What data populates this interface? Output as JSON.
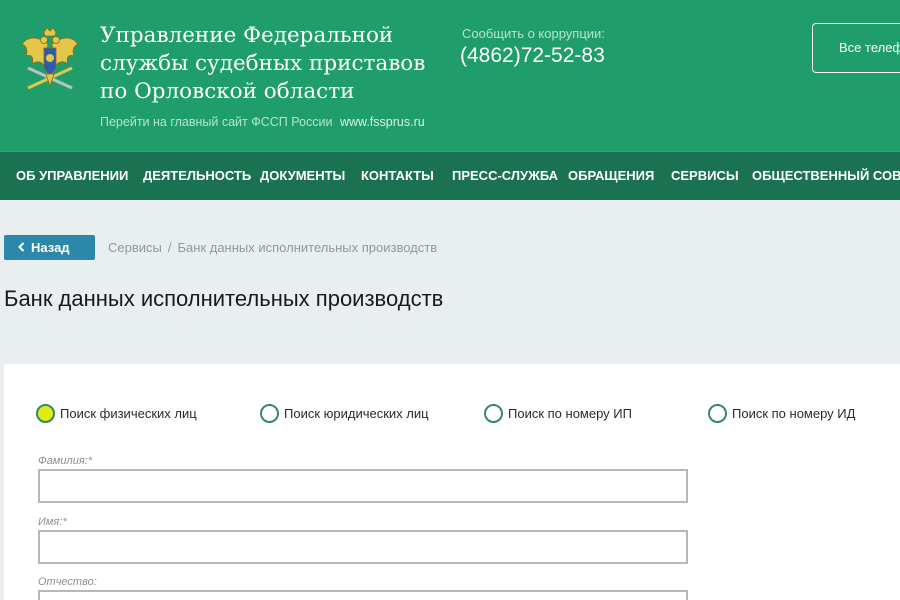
{
  "header": {
    "org_title": "Управление Федеральной службы судебных приставов по Орловской области",
    "main_site_text": "Перейти на главный сайт ФССП России",
    "main_site_url": "www.fssprus.ru",
    "corruption_label": "Сообщить о коррупции:",
    "corruption_phone": "(4862)72-52-83",
    "all_phones_button": "Все телефоны",
    "emblem_icon": "double-headed-eagle-emblem"
  },
  "nav": {
    "items": [
      {
        "label": "ОБ УПРАВЛЕНИИ"
      },
      {
        "label": "ДЕЯТЕЛЬНОСТЬ"
      },
      {
        "label": "ДОКУМЕНТЫ"
      },
      {
        "label": "КОНТАКТЫ"
      },
      {
        "label": "ПРЕСС-СЛУЖБА"
      },
      {
        "label": "ОБРАЩЕНИЯ"
      },
      {
        "label": "СЕРВИСЫ"
      },
      {
        "label": "ОБЩЕСТВЕННЫЙ СОВЕТ"
      }
    ]
  },
  "back_button": {
    "label": "Назад",
    "icon": "chevron-left-icon"
  },
  "breadcrumb": {
    "items": [
      "Сервисы",
      "Банк данных исполнительных производств"
    ],
    "separator": "/"
  },
  "page_title": "Банк данных исполнительных производств",
  "search_form": {
    "search_types": [
      {
        "label": "Поиск физических лиц",
        "selected": true
      },
      {
        "label": "Поиск юридических лиц",
        "selected": false
      },
      {
        "label": "Поиск по номеру ИП",
        "selected": false
      },
      {
        "label": "Поиск по номеру ИД",
        "selected": false
      }
    ],
    "fields": [
      {
        "label": "Фамилия:*",
        "value": ""
      },
      {
        "label": "Имя:*",
        "value": ""
      },
      {
        "label": "Отчество:",
        "value": ""
      }
    ]
  },
  "colors": {
    "header_green": "#1f9e6b",
    "nav_green": "#1b7253",
    "back_button_blue": "#2b88a8",
    "radio_selected": "#e2ea16",
    "page_background": "#e9eef0"
  }
}
